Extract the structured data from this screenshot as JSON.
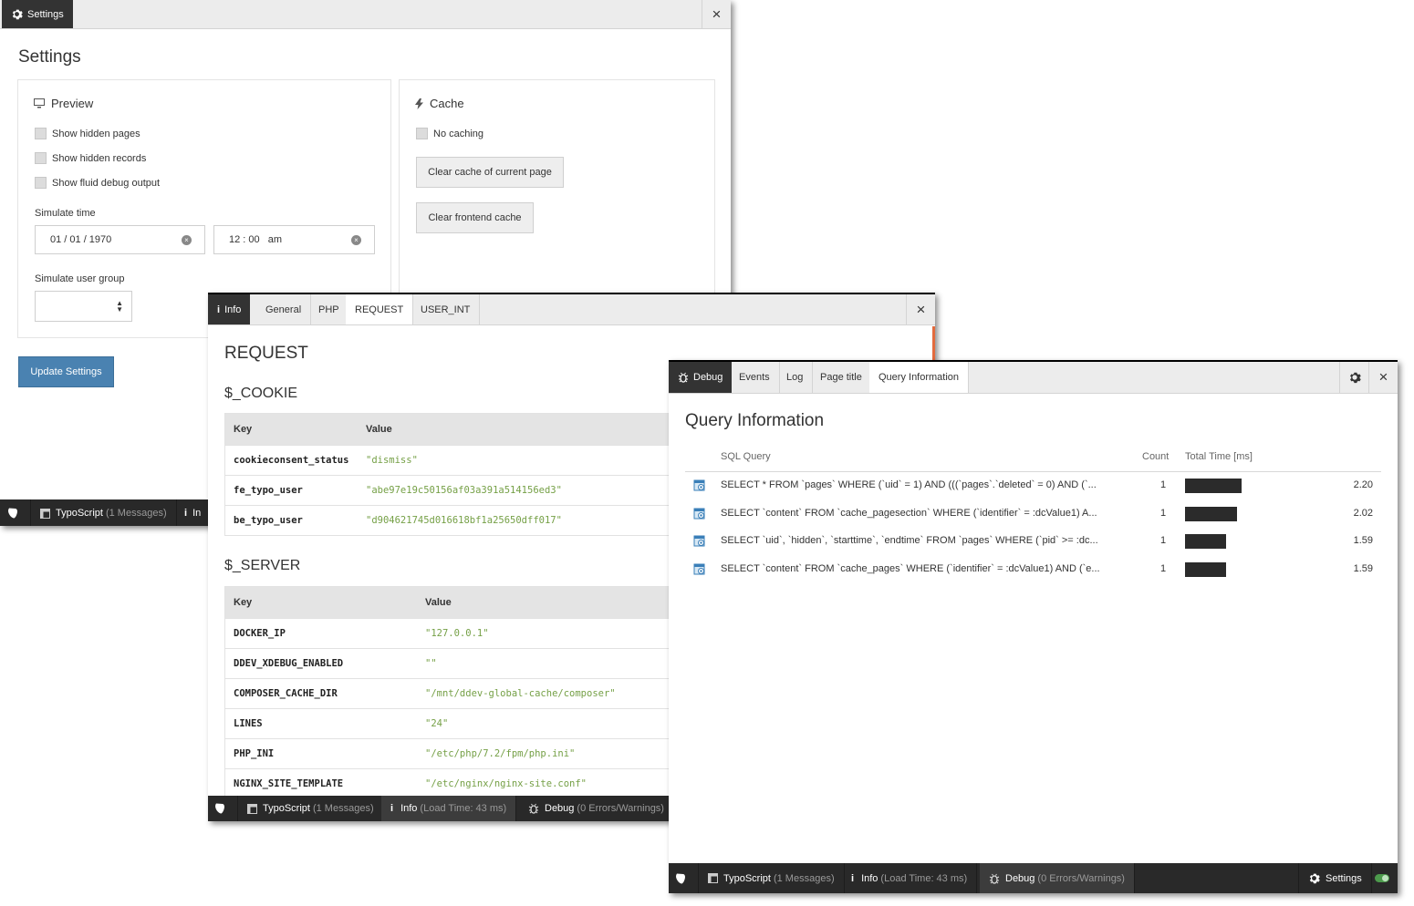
{
  "settings": {
    "tab": "Settings",
    "heading": "Settings",
    "preview": {
      "title": "Preview",
      "checkboxes": [
        "Show hidden pages",
        "Show hidden records",
        "Show fluid debug output"
      ],
      "simulate_time_label": "Simulate time",
      "date_value": "01 / 01 / 1970",
      "time_value": "12 : 00   am",
      "simulate_group_label": "Simulate user group"
    },
    "cache": {
      "title": "Cache",
      "checkbox": "No caching",
      "clear_current": "Clear cache of current page",
      "clear_frontend": "Clear frontend cache"
    },
    "update_button": "Update Settings",
    "toolbar": {
      "typoscript": "TypoScript",
      "typoscript_count": "(1 Messages)",
      "info_partial": "In"
    }
  },
  "request_panel": {
    "tabs": [
      "Info",
      "General",
      "PHP",
      "REQUEST",
      "USER_INT"
    ],
    "heading": "REQUEST",
    "cookie_heading": "$_COOKIE",
    "cookie_cols": [
      "Key",
      "Value"
    ],
    "cookies": [
      {
        "key": "cookieconsent_status",
        "value": "\"dismiss\""
      },
      {
        "key": "fe_typo_user",
        "value": "\"abe97e19c50156af03a391a514156ed3\""
      },
      {
        "key": "be_typo_user",
        "value": "\"d904621745d016618bf1a25650dff017\""
      }
    ],
    "server_heading": "$_SERVER",
    "server_cols": [
      "Key",
      "Value"
    ],
    "server": [
      {
        "key": "DOCKER_IP",
        "value": "\"127.0.0.1\""
      },
      {
        "key": "DDEV_XDEBUG_ENABLED",
        "value": "\"\""
      },
      {
        "key": "COMPOSER_CACHE_DIR",
        "value": "\"/mnt/ddev-global-cache/composer\""
      },
      {
        "key": "LINES",
        "value": "\"24\""
      },
      {
        "key": "PHP_INI",
        "value": "\"/etc/php/7.2/fpm/php.ini\""
      },
      {
        "key": "NGINX_SITE_TEMPLATE",
        "value": "\"/etc/nginx/nginx-site.conf\""
      }
    ],
    "toolbar": {
      "typoscript": "TypoScript",
      "typoscript_count": "(1 Messages)",
      "info": "Info",
      "info_detail": "(Load Time: 43 ms)",
      "debug": "Debug",
      "debug_detail": "(0 Errors/Warnings)"
    }
  },
  "debug_panel": {
    "tabs": [
      "Debug",
      "Events",
      "Log",
      "Page title",
      "Query Information"
    ],
    "heading": "Query Information",
    "columns": {
      "sql": "SQL Query",
      "count": "Count",
      "time": "Total Time [ms]"
    },
    "queries": [
      {
        "sql": "SELECT * FROM `pages` WHERE (`uid` = 1) AND (((`pages`.`deleted` = 0) AND (`...",
        "count": "1",
        "time": "2.20",
        "time_value": 2.2
      },
      {
        "sql": "SELECT `content` FROM `cache_pagesection` WHERE (`identifier` = :dcValue1) A...",
        "count": "1",
        "time": "2.02",
        "time_value": 2.02
      },
      {
        "sql": "SELECT `uid`, `hidden`, `starttime`, `endtime` FROM `pages` WHERE (`pid` >= :dc...",
        "count": "1",
        "time": "1.59",
        "time_value": 1.59
      },
      {
        "sql": "SELECT `content` FROM `cache_pages` WHERE (`identifier` = :dcValue1) AND (`e...",
        "count": "1",
        "time": "1.59",
        "time_value": 1.59
      }
    ],
    "toolbar": {
      "typoscript": "TypoScript",
      "typoscript_count": "(1 Messages)",
      "info": "Info",
      "info_detail": "(Load Time: 43 ms)",
      "debug": "Debug",
      "debug_detail": "(0 Errors/Warnings)",
      "settings": "Settings"
    },
    "colors": {
      "toggle": "#4c9a4c",
      "bar": "#2b2b2b"
    }
  }
}
